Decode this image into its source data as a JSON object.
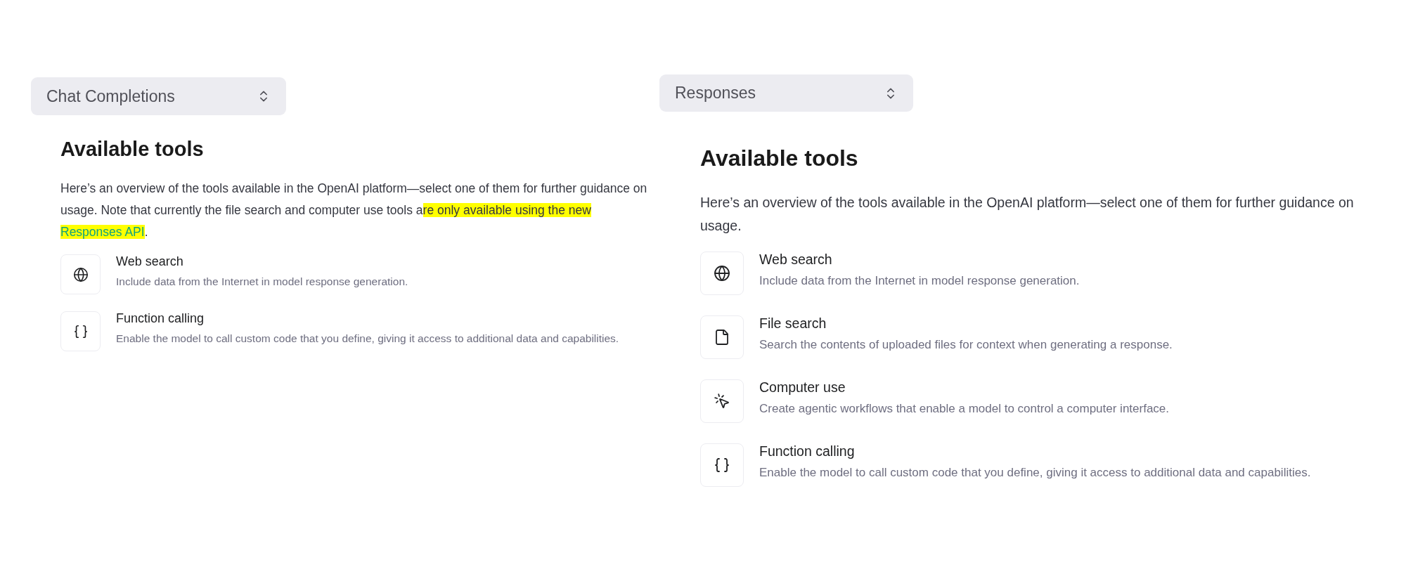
{
  "panels": [
    {
      "select": {
        "value": "Chat Completions"
      },
      "heading": "Available tools",
      "intro": [
        {
          "kind": "text",
          "text": "Here’s an overview of the tools available in the OpenAI platform—select one of them for further guidance on usage. Note that currently the file search and computer use tools a"
        },
        {
          "kind": "highlight",
          "text": "re only available using the new "
        },
        {
          "kind": "highlight_link",
          "text": "Responses API"
        },
        {
          "kind": "text",
          "text": "."
        }
      ],
      "tools": [
        {
          "kind": "globe",
          "title": "Web search",
          "description": "Include data from the Internet in model response generation."
        },
        {
          "kind": "function",
          "title": "Function calling",
          "description": "Enable the model to call custom code that you define, giving it access to additional data and capabilities."
        }
      ]
    },
    {
      "select": {
        "value": "Responses"
      },
      "heading": "Available tools",
      "intro": [
        {
          "kind": "text",
          "text": "Here’s an overview of the tools available in the OpenAI platform—select one of them for further guidance on usage."
        }
      ],
      "tools": [
        {
          "kind": "globe",
          "title": "Web search",
          "description": "Include data from the Internet in model response generation."
        },
        {
          "kind": "file",
          "title": "File search",
          "description": "Search the contents of uploaded files for context when generating a response."
        },
        {
          "kind": "pointer",
          "title": "Computer use",
          "description": "Create agentic workflows that enable a model to control a computer interface."
        },
        {
          "kind": "function",
          "title": "Function calling",
          "description": "Enable the model to call custom code that you define, giving it access to additional data and capabilities."
        }
      ]
    }
  ]
}
